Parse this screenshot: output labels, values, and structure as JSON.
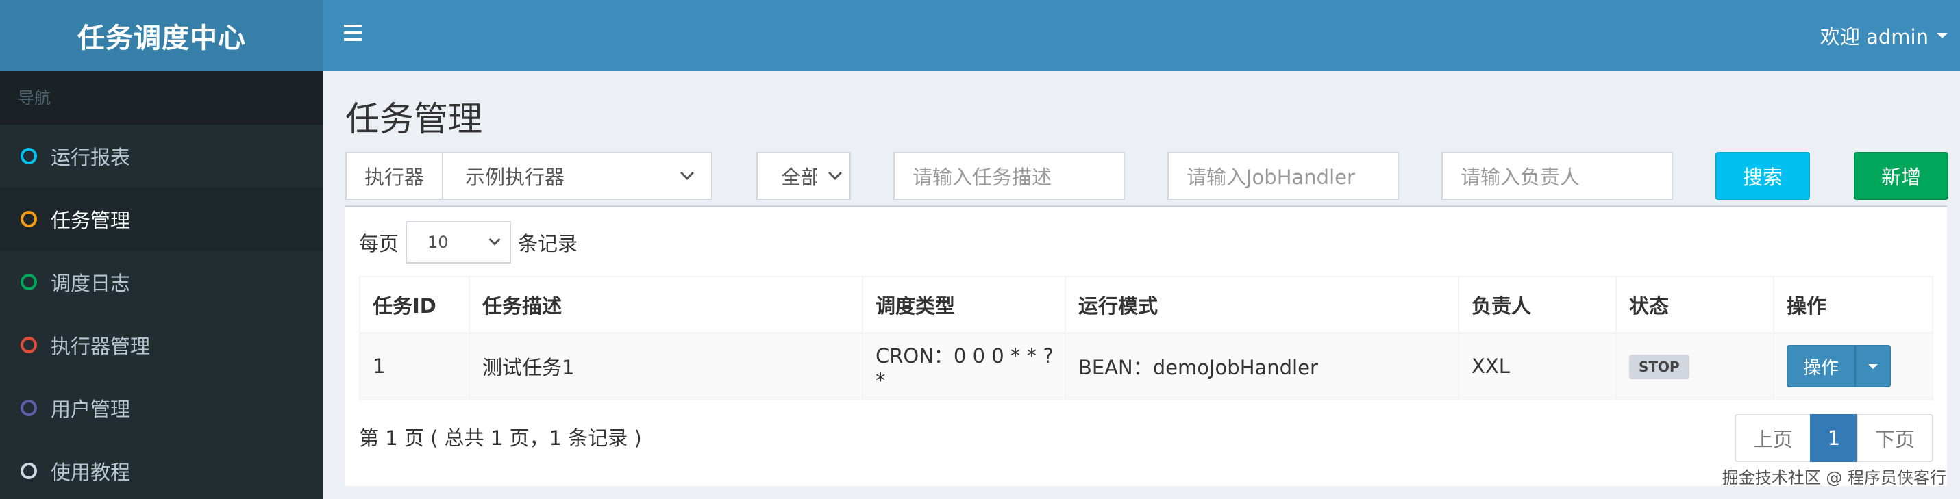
{
  "app": {
    "title": "任务调度中心"
  },
  "header": {
    "welcome": "欢迎 admin"
  },
  "sidebar": {
    "nav_label": "导航",
    "items": [
      {
        "label": "运行报表",
        "color": "#00c0ef"
      },
      {
        "label": "任务管理",
        "color": "#f39c12",
        "active": true
      },
      {
        "label": "调度日志",
        "color": "#00a65a"
      },
      {
        "label": "执行器管理",
        "color": "#dd4b39"
      },
      {
        "label": "用户管理",
        "color": "#605ca8"
      },
      {
        "label": "使用教程",
        "color": "#d2d6de"
      }
    ]
  },
  "page": {
    "title": "任务管理"
  },
  "filters": {
    "executor_label": "执行器",
    "executor_value": "示例执行器",
    "status_value": "全部",
    "desc_placeholder": "请输入任务描述",
    "handler_placeholder": "请输入JobHandler",
    "author_placeholder": "请输入负责人",
    "search_label": "搜索",
    "add_label": "新增"
  },
  "table_controls": {
    "per_page_prefix": "每页",
    "per_page_value": "10",
    "per_page_suffix": "条记录"
  },
  "table": {
    "columns": [
      "任务ID",
      "任务描述",
      "调度类型",
      "运行模式",
      "负责人",
      "状态",
      "操作"
    ],
    "rows": [
      {
        "id": "1",
        "desc": "测试任务1",
        "schedule": "CRON：0 0 0 * * ? *",
        "mode": "BEAN：demoJobHandler",
        "author": "XXL",
        "status": "STOP",
        "action": "操作"
      }
    ]
  },
  "pagination": {
    "info": "第 1 页 ( 总共 1 页，1 条记录 )",
    "prev": "上页",
    "current": "1",
    "next": "下页"
  },
  "watermark": "掘金技术社区 @ 程序员侠客行"
}
